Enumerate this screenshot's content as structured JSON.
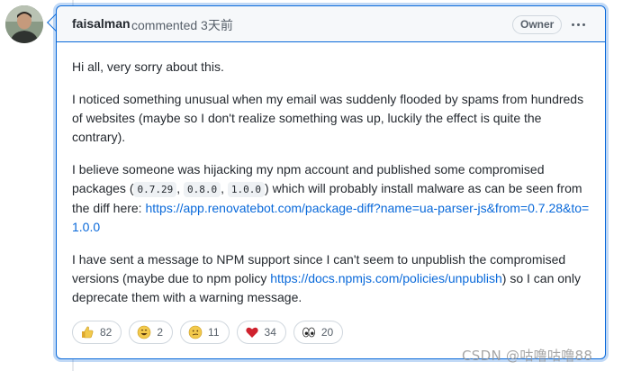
{
  "comment": {
    "author": "faisalman",
    "action_time": "commented 3天前",
    "badge": "Owner",
    "paragraph1": "Hi all, very sorry about this.",
    "paragraph2": "I noticed something unusual when my email was suddenly flooded by spams from hundreds of websites (maybe so I don't realize something was up, luckily the effect is quite the contrary).",
    "p3_text_a": "I believe someone was hijacking my npm account and published some compromised packages (",
    "p3_code1": "0.7.29",
    "p3_sep1": ",",
    "p3_code2": "0.8.0",
    "p3_sep2": ",",
    "p3_code3": "1.0.0",
    "p3_text_b": ") which will probably install malware as can be seen from the diff here:",
    "p3_link": "https://app.renovatebot.com/package-diff?name=ua-parser-js&from=0.7.28&to=1.0.0",
    "p4_text_a": "I have sent a message to NPM support since I can't seem to unpublish the compromised versions (maybe due to npm policy",
    "p4_link": "https://docs.npmjs.com/policies/unpublish",
    "p4_text_b": ") so I can only deprecate them with a warning message."
  },
  "reactions": [
    {
      "icon": "thumbs-up-icon",
      "count": "82"
    },
    {
      "icon": "laugh-icon",
      "count": "2"
    },
    {
      "icon": "confused-icon",
      "count": "11"
    },
    {
      "icon": "heart-icon",
      "count": "34"
    },
    {
      "icon": "eyes-icon",
      "count": "20"
    }
  ],
  "watermark": "CSDN @咕噜咕噜88",
  "colors": {
    "accent": "#0969da",
    "heart": "#cf222e",
    "emoji_yellow": "#f2c94c"
  }
}
